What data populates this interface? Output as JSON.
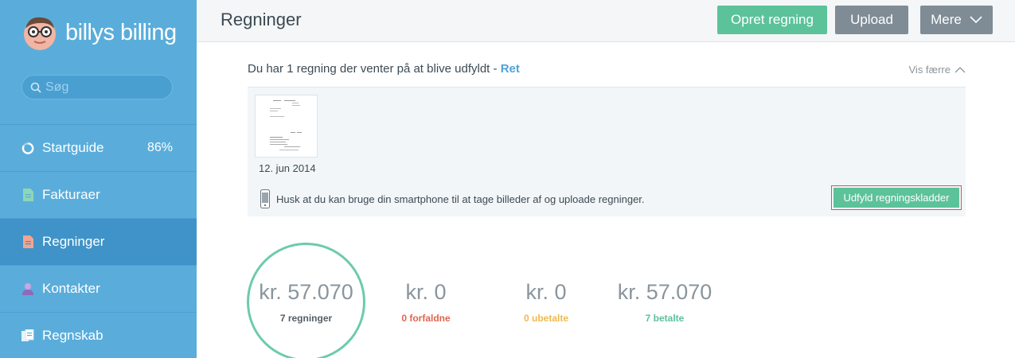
{
  "brand": {
    "name": "billys billing"
  },
  "search": {
    "placeholder": "Søg"
  },
  "sidebar": {
    "items": [
      {
        "label": "Startguide",
        "percent": "86%",
        "icon": "progress-ring-icon",
        "active": false
      },
      {
        "label": "Fakturaer",
        "icon": "invoice-document-icon",
        "active": false
      },
      {
        "label": "Regninger",
        "icon": "bill-document-icon",
        "active": true
      },
      {
        "label": "Kontakter",
        "icon": "person-icon",
        "active": false
      },
      {
        "label": "Regnskab",
        "icon": "ledger-icon",
        "active": false
      }
    ]
  },
  "header": {
    "title": "Regninger",
    "create_label": "Opret regning",
    "upload_label": "Upload",
    "more_label": "Mere"
  },
  "pending": {
    "message": "Du har 1 regning der venter på at blive udfyldt",
    "separator": " - ",
    "link_label": "Ret",
    "toggle_label": "Vis færre",
    "items": [
      {
        "date": "12. jun 2014"
      }
    ],
    "tip": "Husk at du kan bruge din smartphone til at tage billeder af og uploade regninger.",
    "fill_button_label": "Udfyld regningskladder"
  },
  "stats": [
    {
      "amount": "kr. 57.070",
      "label": "7 regninger"
    },
    {
      "amount": "kr. 0",
      "label": "0 forfaldne"
    },
    {
      "amount": "kr. 0",
      "label": "0 ubetalte"
    },
    {
      "amount": "kr. 57.070",
      "label": "7 betalte"
    }
  ],
  "colors": {
    "sidebar": "#5aaddb",
    "sidebar_active": "#3f93c8",
    "primary_green": "#5cc29a",
    "grey_button": "#7f8c95",
    "link_blue": "#4fa3d6",
    "overdue": "#e0654f",
    "unpaid": "#f0b94d",
    "paid": "#5cc29a"
  }
}
